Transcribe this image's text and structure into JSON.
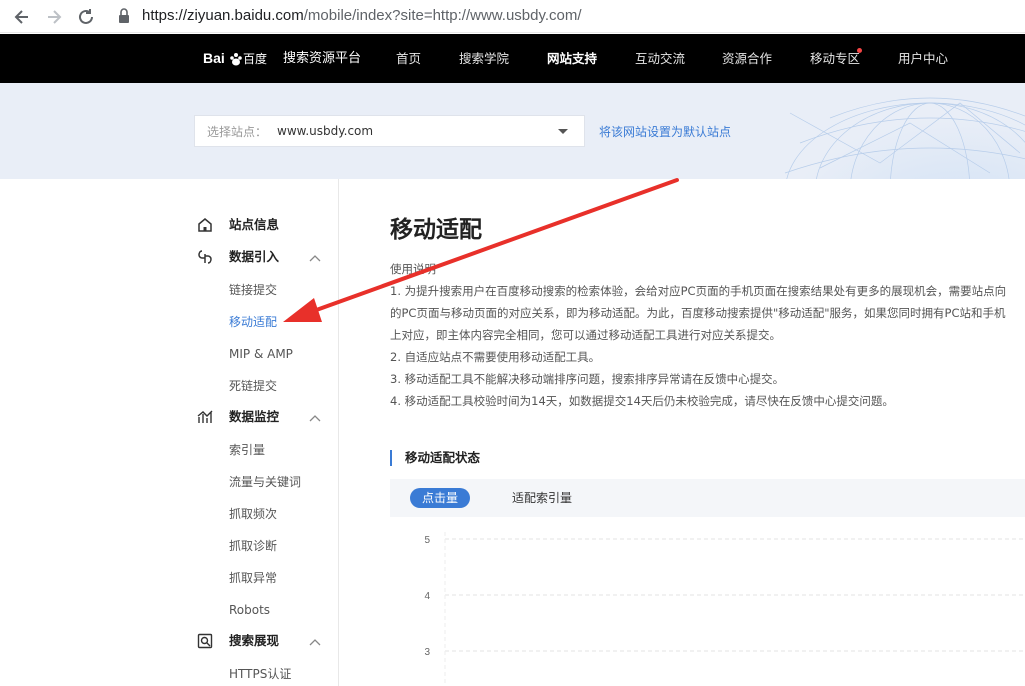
{
  "browser": {
    "url_host": "https://ziyuan.baidu.com",
    "url_path": "/mobile/index?site=http://www.usbdy.com/",
    "back_icon": "arrow-left-icon",
    "forward_icon": "arrow-right-icon",
    "reload_icon": "reload-icon",
    "lock_icon": "lock-icon"
  },
  "topnav": {
    "logo_text": "Bai百度",
    "platform": "搜索资源平台",
    "items": [
      "首页",
      "搜索学院",
      "网站支持",
      "互动交流",
      "资源合作",
      "移动专区",
      "用户中心"
    ],
    "active_index": 2,
    "badge_color": "#f54545"
  },
  "site_select": {
    "label": "选择站点：",
    "value": "www.usbdy.com",
    "set_default_link": "将该网站设置为默认站点"
  },
  "sidebar": {
    "groups": [
      {
        "label": "站点信息",
        "icon": "home-icon",
        "expandable": false
      },
      {
        "label": "数据引入",
        "icon": "data-import-icon",
        "expandable": true,
        "items": [
          "链接提交",
          "移动适配",
          "MIP & AMP",
          "死链提交"
        ]
      },
      {
        "label": "数据监控",
        "icon": "monitor-icon",
        "expandable": true,
        "items": [
          "索引量",
          "流量与关键词",
          "抓取频次",
          "抓取诊断",
          "抓取异常",
          "Robots"
        ]
      },
      {
        "label": "搜索展现",
        "icon": "search-display-icon",
        "expandable": true,
        "items": [
          "HTTPS认证"
        ]
      }
    ],
    "active_item": "移动适配",
    "accent_color": "#3a7bd5"
  },
  "main": {
    "title": "移动适配",
    "notes_title": "使用说明",
    "notes": [
      "1. 为提升搜索用户在百度移动搜索的检索体验，会给对应PC页面的手机页面在搜索结果处有更多的展现机会，需要站点向",
      "的PC页面与移动页面的对应关系，即为移动适配。为此，百度移动搜索提供\"移动适配\"服务，如果您同时拥有PC站和手机",
      "上对应，即主体内容完全相同，您可以通过移动适配工具进行对应关系提交。",
      "2. 自适应站点不需要使用移动适配工具。",
      "3. 移动适配工具不能解决移动端排序问题，搜索排序异常请在反馈中心提交。",
      "4. 移动适配工具校验时间为14天，如数据提交14天后仍未校验完成，请尽快在反馈中心提交问题。"
    ],
    "section_title": "移动适配状态",
    "tabs": [
      "点击量",
      "适配索引量"
    ],
    "active_tab": 0
  },
  "chart_data": {
    "type": "line",
    "y_ticks": [
      5,
      4,
      3
    ],
    "ylim": [
      3,
      5
    ],
    "grid": true,
    "series": []
  },
  "annotation": {
    "arrow_color": "#e8302a"
  }
}
